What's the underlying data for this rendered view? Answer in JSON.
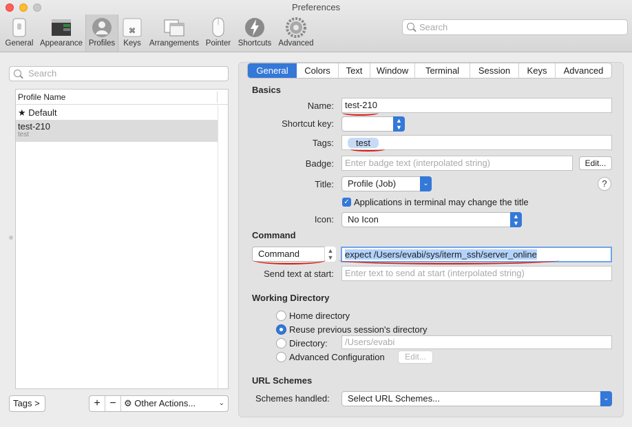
{
  "window": {
    "title": "Preferences"
  },
  "toolbar": {
    "items": [
      {
        "label": "General",
        "icon": "switch-icon"
      },
      {
        "label": "Appearance",
        "icon": "terminal-window-icon"
      },
      {
        "label": "Profiles",
        "icon": "person-icon"
      },
      {
        "label": "Keys",
        "icon": "command-key-icon"
      },
      {
        "label": "Arrangements",
        "icon": "windows-icon"
      },
      {
        "label": "Pointer",
        "icon": "mouse-icon"
      },
      {
        "label": "Shortcuts",
        "icon": "lightning-icon"
      },
      {
        "label": "Advanced",
        "icon": "gear-icon"
      }
    ],
    "selected": "Profiles",
    "search_placeholder": "Search"
  },
  "profiles": {
    "search_placeholder": "Search",
    "column_header": "Profile Name",
    "rows": [
      {
        "name": "★ Default",
        "tags": ""
      },
      {
        "name": "test-210",
        "tags": "test"
      }
    ],
    "tags_button": "Tags >",
    "add_button": "+",
    "remove_button": "−",
    "other_actions": "Other Actions..."
  },
  "tabs": [
    "General",
    "Colors",
    "Text",
    "Window",
    "Terminal",
    "Session",
    "Keys",
    "Advanced"
  ],
  "selected_tab": "General",
  "basics": {
    "heading": "Basics",
    "name_label": "Name:",
    "name_value": "test-210",
    "shortcut_label": "Shortcut key:",
    "shortcut_value": "",
    "tags_label": "Tags:",
    "tags_value": "test",
    "badge_label": "Badge:",
    "badge_placeholder": "Enter badge text (interpolated string)",
    "badge_edit": "Edit...",
    "title_label": "Title:",
    "title_value": "Profile (Job)",
    "help": "?",
    "title_checkbox": "Applications in terminal may change the title",
    "icon_label": "Icon:",
    "icon_value": "No Icon"
  },
  "command": {
    "heading": "Command",
    "mode_value": "Command",
    "command_value": "expect /Users/evabi/sys/iterm_ssh/server_online",
    "send_label": "Send text at start:",
    "send_placeholder": "Enter text to send at start (interpolated string)"
  },
  "working_directory": {
    "heading": "Working Directory",
    "options": [
      "Home directory",
      "Reuse previous session's directory",
      "Directory:",
      "Advanced Configuration"
    ],
    "selected": "Reuse previous session's directory",
    "directory_value": "/Users/evabi",
    "edit_button": "Edit..."
  },
  "url_schemes": {
    "heading": "URL Schemes",
    "label": "Schemes handled:",
    "value": "Select URL Schemes..."
  },
  "colors": {
    "accent": "#3478d8",
    "annotation_red": "#d91a12"
  }
}
